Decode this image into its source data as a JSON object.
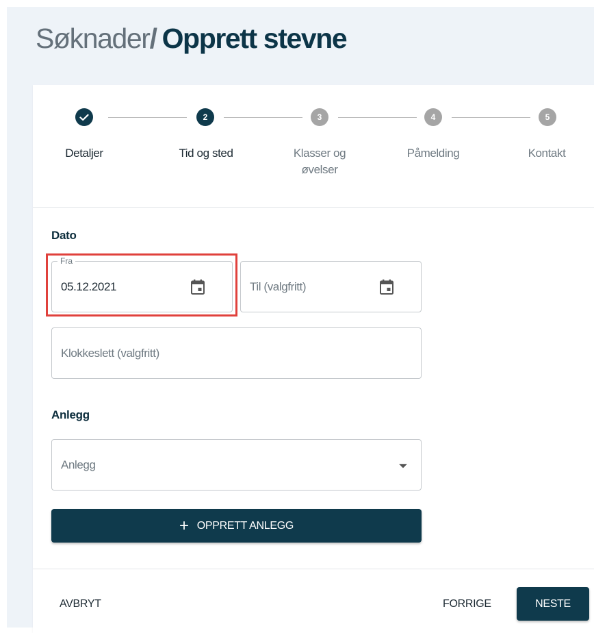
{
  "header": {
    "breadcrumb_parent": "Søknader",
    "separator": "/",
    "title": "Opprett stevne"
  },
  "stepper": {
    "steps": [
      {
        "number": "✓",
        "label_line1": "Detaljer",
        "label_line2": "",
        "state": "done"
      },
      {
        "number": "2",
        "label_line1": "Tid og sted",
        "label_line2": "",
        "state": "active"
      },
      {
        "number": "3",
        "label_line1": "Klasser og",
        "label_line2": "øvelser",
        "state": "pending"
      },
      {
        "number": "4",
        "label_line1": "Påmelding",
        "label_line2": "",
        "state": "pending"
      },
      {
        "number": "5",
        "label_line1": "Kontakt",
        "label_line2": "",
        "state": "pending"
      }
    ]
  },
  "dato": {
    "section_title": "Dato",
    "fra_label": "Fra",
    "fra_value": "05.12.2021",
    "til_placeholder": "Til (valgfritt)",
    "klokkeslett_placeholder": "Klokkeslett (valgfritt)"
  },
  "anlegg": {
    "section_title": "Anlegg",
    "select_placeholder": "Anlegg",
    "create_button_icon": "+",
    "create_button_label": "OPPRETT ANLEGG"
  },
  "footer": {
    "cancel_label": "AVBRYT",
    "previous_label": "FORRIGE",
    "next_label": "NESTE"
  },
  "icons": {
    "calendar": "calendar-icon",
    "dropdown": "chevron-down-icon",
    "check": "check-icon"
  },
  "colors": {
    "primary": "#0f3a4c",
    "pending_step": "#a5a5a5",
    "highlight": "#e0413c",
    "page_background": "#eef3f8"
  }
}
